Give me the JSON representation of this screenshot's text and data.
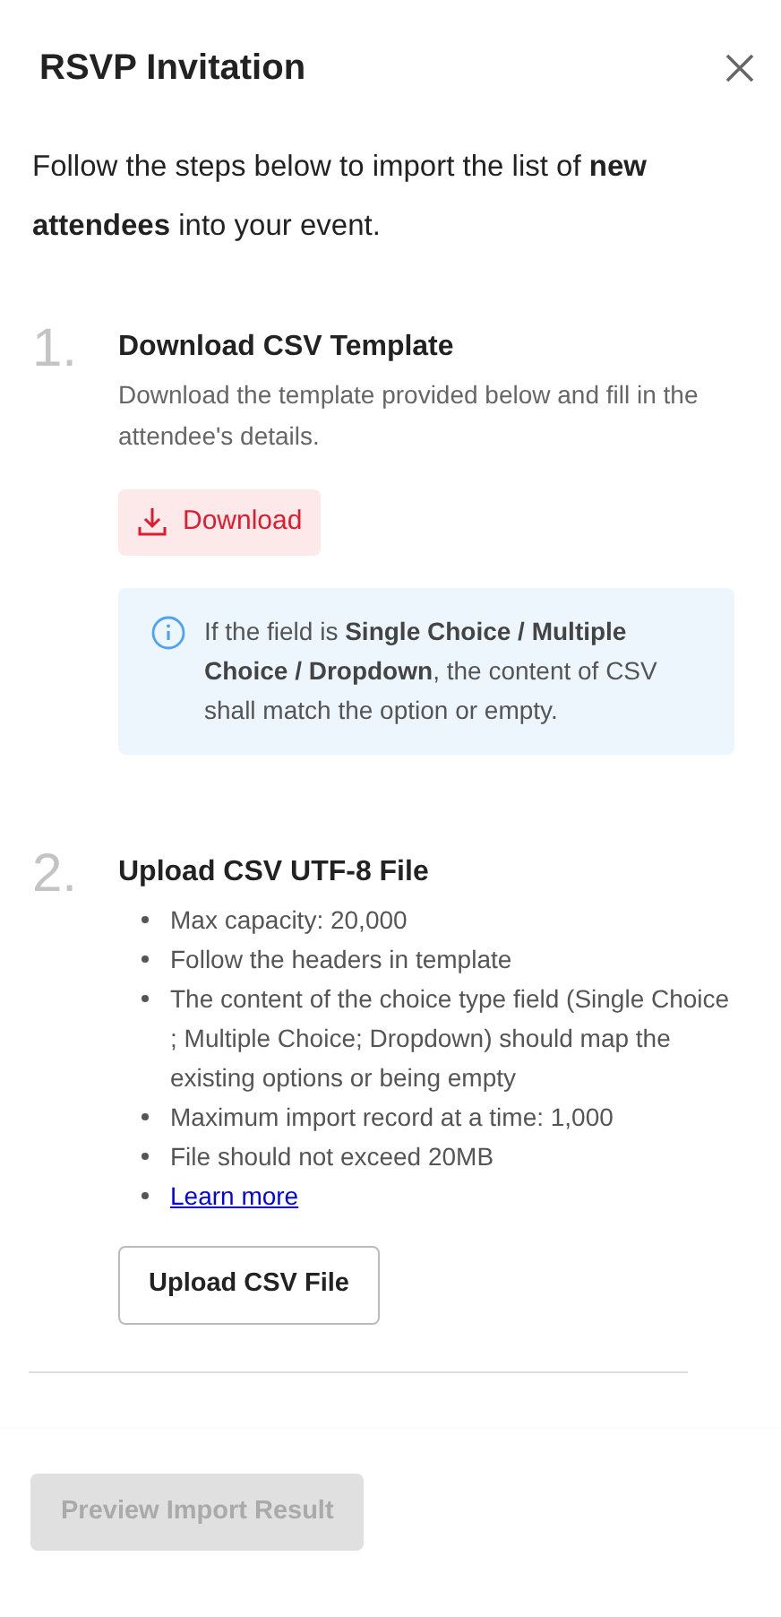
{
  "dialog": {
    "title": "RSVP Invitation"
  },
  "intro": "Follow the steps below to import the list of **new attendees** into your event.",
  "steps": [
    {
      "number": "1.",
      "title": "Download CSV Template",
      "description": "Download the template provided below and fill in the attendee's details.",
      "download_button": "Download",
      "info": "If the field is **Single Choice / Multiple Choice / Dropdown**, the content of CSV shall match the option or empty."
    },
    {
      "number": "2.",
      "title": "Upload CSV UTF-8 File",
      "bullets": [
        {
          "kind": "text",
          "text": "Max capacity: 20,000"
        },
        {
          "kind": "text",
          "text": "Follow the headers in template"
        },
        {
          "kind": "text",
          "text": "The content of the choice type field (Single Choice ; Multiple Choice; Dropdown) should map the existing options or being empty"
        },
        {
          "kind": "text",
          "text": "Maximum import record at a time: 1,000"
        },
        {
          "kind": "text",
          "text": "File should not exceed 20MB"
        },
        {
          "kind": "link",
          "text": "Learn more"
        }
      ],
      "upload_button": "Upload CSV File"
    }
  ],
  "footer": {
    "button": {
      "label": "Preview Import Result",
      "disabled": true
    }
  }
}
